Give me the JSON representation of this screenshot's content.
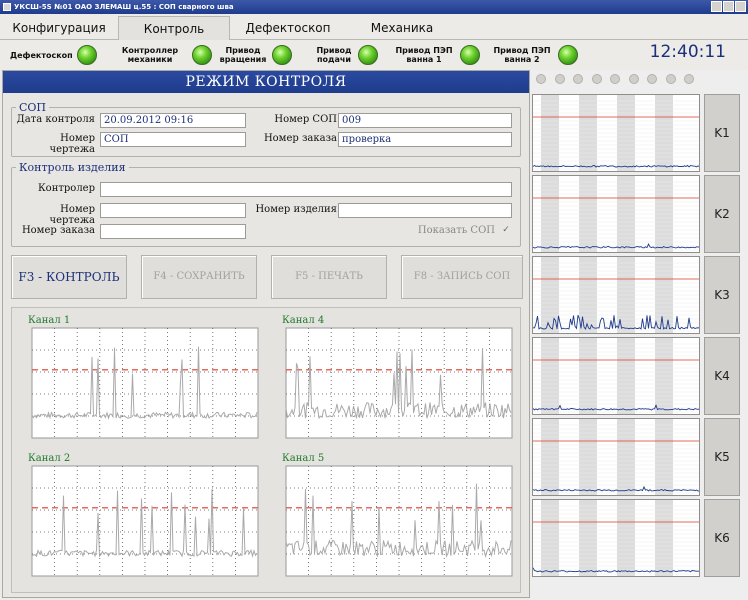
{
  "window": {
    "title": "УКСШ-5S №01 ОАО ЗЛЕМАШ ц.55 : СОП сварного шва"
  },
  "menu": {
    "tabs": [
      "Конфигурация",
      "Контроль",
      "Дефектоскоп",
      "Механика"
    ],
    "active": 1
  },
  "status": {
    "indicators": [
      {
        "label": "Дефектоскоп"
      },
      {
        "label": "Контроллер механики"
      },
      {
        "label": "Привод вращения"
      },
      {
        "label": "Привод подачи"
      },
      {
        "label": "Привод ПЭП ванна 1"
      },
      {
        "label": "Привод ПЭП ванна 2"
      }
    ],
    "clock": "12:40:11",
    "led_color": "#5cc52a"
  },
  "mode": {
    "title": "РЕЖИМ КОНТРОЛЯ"
  },
  "sop": {
    "legend": "СОП",
    "date_label": "Дата контроля",
    "date_value": "20.09.2012  09:16",
    "sop_no_label": "Номер СОП",
    "sop_no_value": "009",
    "drawing_label": "Номер чертежа",
    "drawing_value": "СОП",
    "order_label": "Номер заказа",
    "order_value": "проверка"
  },
  "product": {
    "legend": "Контроль изделия",
    "controller_label": "Контролер",
    "controller_value": "",
    "drawing_label": "Номер чертежа",
    "drawing_value": "",
    "product_no_label": "Номер изделия",
    "product_no_value": "",
    "order_label": "Номер заказа",
    "order_value": "",
    "show_sop_label": "Показать СОП",
    "show_sop_checked": true
  },
  "buttons": {
    "f3": "F3 - КОНТРОЛЬ",
    "f4": "F4 - СОХРАНИТЬ",
    "f5": "F5 - ПЕЧАТЬ",
    "f8": "F8 - ЗАПИСЬ СОП"
  },
  "channels": [
    "Канал 1",
    "Канал 4",
    "Канал 2",
    "Канал 5"
  ],
  "strips": [
    "K1",
    "K2",
    "K3",
    "K4",
    "K5",
    "K6"
  ],
  "colors": {
    "accent": "#1f3c8c",
    "channel_label": "#1f7a2d",
    "threshold": "#e03a2a",
    "signal": "#a9a9a9"
  }
}
